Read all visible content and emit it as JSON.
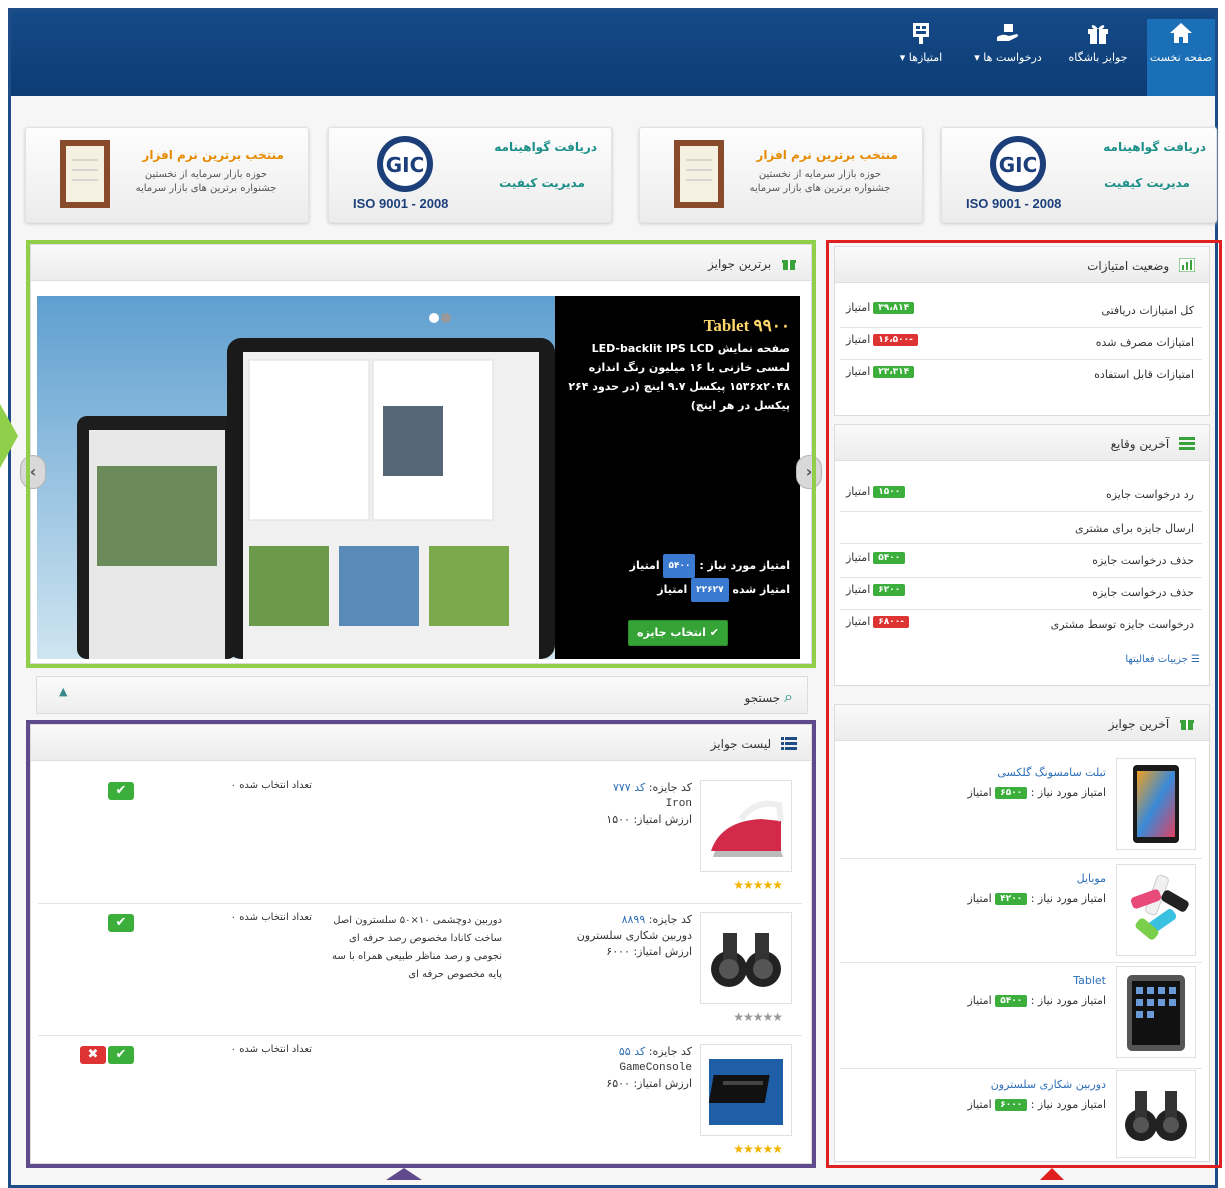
{
  "nav": {
    "items": [
      {
        "label": "صفحه نخست",
        "icon": "home-icon",
        "active": true
      },
      {
        "label": "جوایز باشگاه",
        "icon": "gift-icon"
      },
      {
        "label": "درخواست ها ▾",
        "icon": "hand-gift-icon"
      },
      {
        "label": "امتیازها ▾",
        "icon": "scoreboard-icon"
      }
    ]
  },
  "certs": [
    {
      "type": "award",
      "title": "منتخب برترین نرم افزار",
      "line1": "حوزه بازار سرمایه از نخستین",
      "line2": "جشنواره برترین های بازار سرمایه"
    },
    {
      "type": "iso",
      "title": "دریافت گواهینامه",
      "subtitle": "مدیریت کیفیت",
      "iso_text": "ISO 9001 - 2008"
    },
    {
      "type": "award",
      "title": "منتخب برترین نرم افزار",
      "line1": "حوزه بازار سرمایه از نخستین",
      "line2": "جشنواره برترین های بازار سرمایه"
    },
    {
      "type": "iso",
      "title": "دریافت گواهینامه",
      "subtitle": "مدیریت کیفیت",
      "iso_text": "ISO 9001 - 2008"
    }
  ],
  "top_prizes": {
    "title": "برترین جوایز",
    "slide": {
      "product_title": "Tablet ۹۹۰۰",
      "description": "صفحه نمایش LED-backlit IPS LCD لمسی خازنی با ۱۶ میلیون رنگ اندازه ۱۵۳۶x۲۰۴۸ پیکسل ۹.۷ اینچ (در حدود ۲۶۴ پیکسل در هر اینچ)",
      "need_label": "امتیاز مورد نیاز :",
      "need_value": "۵۴۰۰",
      "spent_label": "امتیاز شده",
      "spent_value": "۲۲۶۲۷",
      "unit": "امتیاز",
      "select_button": "✔ انتخاب جایزه"
    }
  },
  "search": {
    "label": "جستجو"
  },
  "prize_list": {
    "title": "لیست جوایز",
    "rows": [
      {
        "code_label": "کد جایزه:",
        "code": "کد ۷۷۷",
        "name": "Iron",
        "value_label": "ارزش امتیاز:",
        "value": "۱۵۰۰",
        "desc": "",
        "count_label": "تعداد انتخاب شده",
        "count": "۰",
        "stars": "★★★★★",
        "status": [
          "ok"
        ]
      },
      {
        "code_label": "کد جایزه:",
        "code": "۸۸۹۹",
        "name": "دوربین شکاری سلسترون",
        "value_label": "ارزش امتیاز:",
        "value": "۶۰۰۰",
        "desc": "دوربین دوچشمی ۱۰×۵۰ سلسترون اصل ساخت کانادا مخصوص رصد حرفه ای نجومی و رصد مناظر طبیعی همراه با سه پایه مخصوص حرفه ای",
        "count_label": "تعداد انتخاب شده",
        "count": "۰",
        "stars": "★★★★★",
        "status": [
          "ok"
        ]
      },
      {
        "code_label": "کد جایزه:",
        "code": "کد ۵۵",
        "name": "GameConsole",
        "value_label": "ارزش امتیاز:",
        "value": "۶۵۰۰",
        "desc": "",
        "count_label": "تعداد انتخاب شده",
        "count": "۰",
        "stars": "★★★★★",
        "status": [
          "ok",
          "no"
        ]
      }
    ]
  },
  "score_status": {
    "title": "وضعیت امتیازات",
    "unit": "امتیاز",
    "rows": [
      {
        "label": "کل امتیازات دریافتی",
        "value": "۳۹،۸۱۴",
        "color": "#3cae3c"
      },
      {
        "label": "امتیازات مصرف شده",
        "value": "-۱۶،۵۰۰",
        "color": "#dd3333"
      },
      {
        "label": "امتیازات قابل استفاده",
        "value": "۲۳،۳۱۴",
        "color": "#3cae3c"
      }
    ]
  },
  "latest_events": {
    "title": "آخرین وقایع",
    "unit": "امتیاز",
    "rows": [
      {
        "label": "رد درخواست جایزه",
        "value": "۱۵۰۰",
        "color": "#3cae3c"
      },
      {
        "label": "ارسال جایزه برای مشتری",
        "value": "",
        "color": ""
      },
      {
        "label": "حذف درخواست جایزه",
        "value": "۵۴۰۰",
        "color": "#3cae3c"
      },
      {
        "label": "حذف درخواست جایزه",
        "value": "۶۲۰۰",
        "color": "#3cae3c"
      },
      {
        "label": "درخواست جایزه توسط مشتری",
        "value": "-۶۸۰۰",
        "color": "#dd3333"
      }
    ],
    "details_link": "جزییات فعالیتها"
  },
  "latest_prizes": {
    "title": "آخرین جوایز",
    "need_label": "امتیاز مورد نیاز :",
    "unit": "امتیاز",
    "items": [
      {
        "name": "تبلت سامسونگ گلکسی",
        "value": "۶۵۰۰",
        "icon": "tablet-icon"
      },
      {
        "name": "موبایل",
        "value": "۴۲۰۰",
        "icon": "usb-drives-icon"
      },
      {
        "name": "Tablet",
        "value": "۵۴۰۰",
        "icon": "ipad-icon"
      },
      {
        "name": "دوربین شکاری سلسترون",
        "value": "۶۰۰۰",
        "icon": "binoculars-icon"
      }
    ]
  }
}
